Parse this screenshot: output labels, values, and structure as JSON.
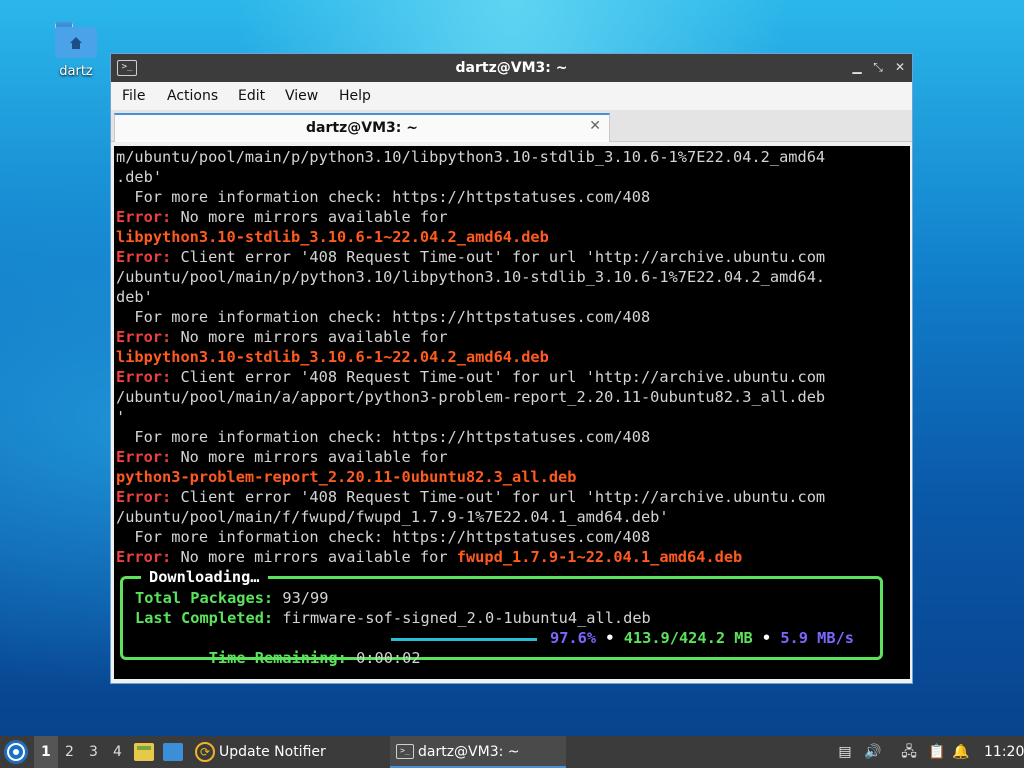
{
  "desktop": {
    "icon_label": "dartz"
  },
  "window": {
    "title": "dartz@VM3: ~",
    "icon": "terminal-icon",
    "menu": [
      "File",
      "Actions",
      "Edit",
      "View",
      "Help"
    ],
    "tab_label": "dartz@VM3: ~"
  },
  "terminal": {
    "lines": [
      {
        "t": "m/ubuntu/pool/main/p/python3.10/libpython3.10-stdlib_3.10.6-1%7E22.04.2_amd64"
      },
      {
        "t": ".deb'"
      },
      {
        "t": "  For more information check: https://httpstatuses.com/408"
      },
      {
        "e": "Error:",
        "t": " No more mirrors available for"
      },
      {
        "p": "libpython3.10-stdlib_3.10.6-1~22.04.2_amd64.deb"
      },
      {
        "e": "Error:",
        "t": " Client error '408 Request Time-out' for url 'http://archive.ubuntu.com"
      },
      {
        "t": "/ubuntu/pool/main/p/python3.10/libpython3.10-stdlib_3.10.6-1%7E22.04.2_amd64."
      },
      {
        "t": "deb'"
      },
      {
        "t": "  For more information check: https://httpstatuses.com/408"
      },
      {
        "e": "Error:",
        "t": " No more mirrors available for"
      },
      {
        "p": "libpython3.10-stdlib_3.10.6-1~22.04.2_amd64.deb"
      },
      {
        "e": "Error:",
        "t": " Client error '408 Request Time-out' for url 'http://archive.ubuntu.com"
      },
      {
        "t": "/ubuntu/pool/main/a/apport/python3-problem-report_2.20.11-0ubuntu82.3_all.deb"
      },
      {
        "t": "'"
      },
      {
        "t": "  For more information check: https://httpstatuses.com/408"
      },
      {
        "e": "Error:",
        "t": " No more mirrors available for"
      },
      {
        "p": "python3-problem-report_2.20.11-0ubuntu82.3_all.deb"
      },
      {
        "e": "Error:",
        "t": " Client error '408 Request Time-out' for url 'http://archive.ubuntu.com"
      },
      {
        "t": "/ubuntu/pool/main/f/fwupd/fwupd_1.7.9-1%7E22.04.1_amd64.deb'"
      },
      {
        "t": "  For more information check: https://httpstatuses.com/408"
      },
      {
        "e": "Error:",
        "t": " No more mirrors available for ",
        "p": "fwupd_1.7.9-1~22.04.1_amd64.deb"
      }
    ],
    "progress": {
      "title": "Downloading…",
      "total_label": "Total Packages:",
      "total_value": "93/99",
      "last_label": "Last Completed:",
      "last_value": "firmware-sof-signed_2.0-1ubuntu4_all.deb",
      "remain_label": "Time Remaining:",
      "remain_value": "0:00:02",
      "fraction": 0.976,
      "percent": "97.6%",
      "size": "413.9/424.2 MB",
      "speed": "5.9 MB/s",
      "sep": "•"
    },
    "colors": {
      "error": "#ef3f3f",
      "package": "#ff5a1f",
      "green": "#5be35b",
      "purple": "#7a67ff"
    }
  },
  "taskbar": {
    "workspaces": [
      "1",
      "2",
      "3",
      "4"
    ],
    "active_workspace": "1",
    "update_label": "Update Notifier",
    "terminal_task": "dartz@VM3: ~",
    "clock": "11:20"
  }
}
